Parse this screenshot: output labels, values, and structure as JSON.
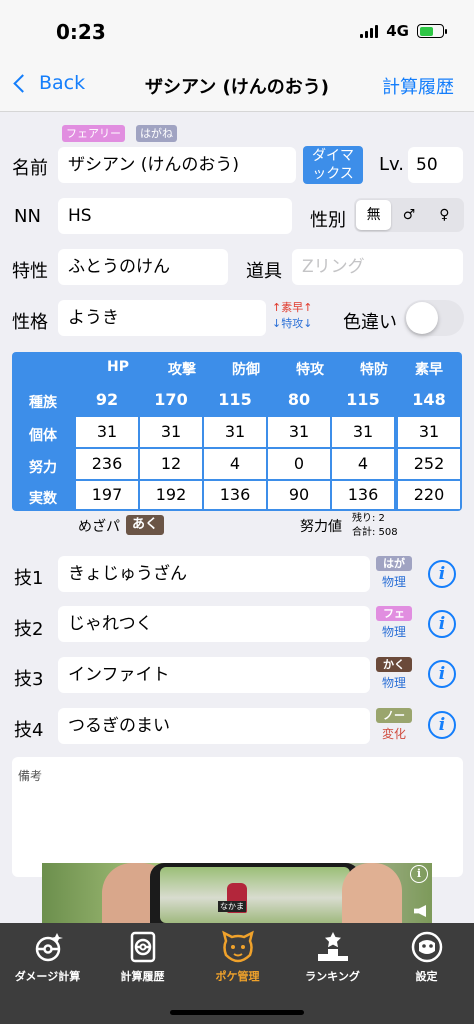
{
  "status": {
    "time": "0:23",
    "network": "4G"
  },
  "nav": {
    "back_label": "Back",
    "title": "ザシアン (けんのおう)",
    "history_label": "計算履歴"
  },
  "types": [
    {
      "label": "フェアリー",
      "color": "#e18ee0"
    },
    {
      "label": "はがね",
      "color": "#a0a3c2"
    }
  ],
  "form": {
    "name_label": "名前",
    "name_value": "ザシアン (けんのおう)",
    "dynamax_line1": "ダイマ",
    "dynamax_line2": "ックス",
    "level_label": "Lv.",
    "level_value": "50",
    "nickname_label": "NN",
    "nickname_value": "HS",
    "gender_label": "性別",
    "gender_options": [
      "無",
      "♂",
      "♀"
    ],
    "gender_selected": "無",
    "ability_label": "特性",
    "ability_value": "ふとうのけん",
    "item_label": "道具",
    "item_placeholder": "Zリング",
    "nature_label": "性格",
    "nature_value": "ようき",
    "nature_up": "↑素早↑",
    "nature_down": "↓特攻↓",
    "shiny_label": "色違い",
    "shiny_on": false
  },
  "stats": {
    "columns": [
      "HP",
      "攻撃",
      "防御",
      "特攻",
      "特防",
      "素早"
    ],
    "rows": [
      {
        "label": "種族",
        "values": [
          "92",
          "170",
          "115",
          "80",
          "115",
          "148"
        ]
      },
      {
        "label": "個体",
        "values": [
          "31",
          "31",
          "31",
          "31",
          "31",
          "31"
        ]
      },
      {
        "label": "努力",
        "values": [
          "236",
          "12",
          "4",
          "0",
          "4",
          "252"
        ]
      },
      {
        "label": "実数",
        "values": [
          "197",
          "192",
          "136",
          "90",
          "136",
          "220"
        ]
      }
    ]
  },
  "hidden_power": {
    "label": "めざパ",
    "type": "あく"
  },
  "ev_summary": {
    "label": "努力値",
    "remaining": "残り: 2",
    "total": "合計: 508"
  },
  "moves": [
    {
      "label": "技1",
      "name": "きょじゅうざん",
      "type": "はが",
      "type_color": "#a0a3c2",
      "category": "物理"
    },
    {
      "label": "技2",
      "name": "じゃれつく",
      "type": "フェ",
      "type_color": "#e18ee0",
      "category": "物理"
    },
    {
      "label": "技3",
      "name": "インファイト",
      "type": "かく",
      "type_color": "#6b4a3a",
      "category": "物理"
    },
    {
      "label": "技4",
      "name": "つるぎのまい",
      "type": "ノー",
      "type_color": "#9aa56e",
      "category": "変化"
    }
  ],
  "info_glyph": "i",
  "memo_label": "備考",
  "ad": {
    "character_tag": "なかま",
    "info_glyph": "i"
  },
  "tabs": [
    {
      "label": "ダメージ計算",
      "icon": "damage-calc-icon"
    },
    {
      "label": "計算履歴",
      "icon": "history-icon"
    },
    {
      "label": "ポケ管理",
      "icon": "poke-manage-icon",
      "active": true
    },
    {
      "label": "ランキング",
      "icon": "ranking-icon"
    },
    {
      "label": "設定",
      "icon": "settings-icon"
    }
  ],
  "colors": {
    "accent": "#147efb",
    "stats_bg": "#3d8ee9",
    "tab_active": "#f0a22b",
    "tabbar_bg": "#3d3d3d"
  }
}
